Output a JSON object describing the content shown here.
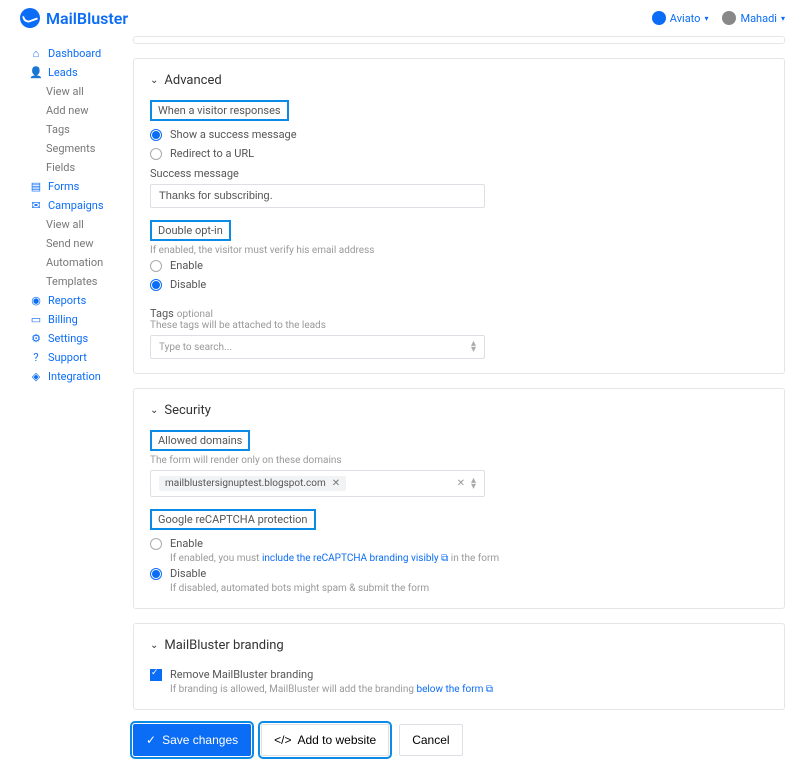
{
  "header": {
    "brand": "MailBluster",
    "org": "Aviato",
    "user": "Mahadi"
  },
  "sidebar": {
    "items": [
      {
        "label": "Dashboard",
        "icon": "home"
      },
      {
        "label": "Leads",
        "icon": "user"
      },
      {
        "label": "View all",
        "sub": true
      },
      {
        "label": "Add new",
        "sub": true
      },
      {
        "label": "Tags",
        "sub": true
      },
      {
        "label": "Segments",
        "sub": true
      },
      {
        "label": "Fields",
        "sub": true
      },
      {
        "label": "Forms",
        "icon": "form"
      },
      {
        "label": "Campaigns",
        "icon": "mail"
      },
      {
        "label": "View all",
        "sub": true
      },
      {
        "label": "Send new",
        "sub": true
      },
      {
        "label": "Automation",
        "sub": true
      },
      {
        "label": "Templates",
        "sub": true
      },
      {
        "label": "Reports",
        "icon": "chart"
      },
      {
        "label": "Billing",
        "icon": "card"
      },
      {
        "label": "Settings",
        "icon": "gear"
      },
      {
        "label": "Support",
        "icon": "help"
      },
      {
        "label": "Integration",
        "icon": "plug"
      }
    ]
  },
  "advanced": {
    "title": "Advanced",
    "responseHeader": "When a visitor responses",
    "opt1": "Show a success message",
    "opt2": "Redirect to a URL",
    "successLabel": "Success message",
    "successValue": "Thanks for subscribing.",
    "doubleOptHeader": "Double opt-in",
    "doubleOptHint": "If enabled, the visitor must verify his email address",
    "enable": "Enable",
    "disable": "Disable",
    "tagsLabel": "Tags",
    "tagsOpt": "optional",
    "tagsHint": "These tags will be attached to the leads",
    "tagsPlaceholder": "Type to search..."
  },
  "security": {
    "title": "Security",
    "allowedHeader": "Allowed domains",
    "allowedHint": "The form will render only on these domains",
    "domainChip": "mailblustersignuptest.blogspot.com",
    "captchaHeader": "Google reCAPTCHA protection",
    "enable": "Enable",
    "enableHint1": "If enabled, you must ",
    "enableLink": "include the reCAPTCHA branding visibly",
    "enableHint2": " in the form",
    "disable": "Disable",
    "disableHint": "If disabled, automated bots might spam & submit the form"
  },
  "branding": {
    "title": "MailBluster branding",
    "removeLabel": "Remove MailBluster branding",
    "hint1": "If branding is allowed, MailBluster will add the branding ",
    "hintLink": "below the form"
  },
  "buttons": {
    "save": "Save changes",
    "add": "Add to website",
    "cancel": "Cancel"
  }
}
